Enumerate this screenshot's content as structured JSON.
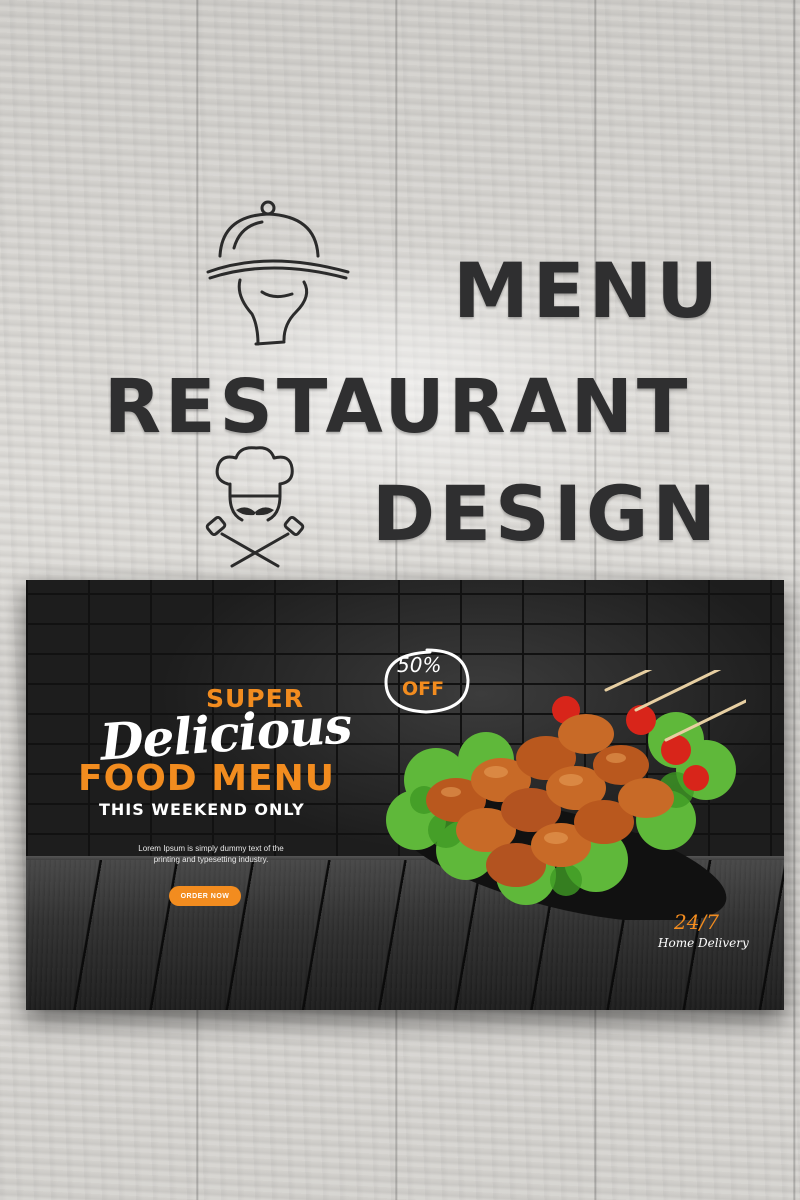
{
  "header": {
    "line1": "MENU",
    "line2": "RESTAURANT",
    "line3": "DESIGN",
    "icons": [
      "cloche-hand-icon",
      "chef-mustache-icon"
    ]
  },
  "banner": {
    "super": "SUPER",
    "delicious": "Delicious",
    "food_menu": "FOOD MENU",
    "weekend": "THIS WEEKEND ONLY",
    "body_line1": "Lorem Ipsum is simply dummy text of the",
    "body_line2": "printing and typesetting industry.",
    "order_button": "ORDER NOW",
    "discount_pct": "50%",
    "discount_off": "OFF",
    "hours": "24/7",
    "delivery": "Home Delivery",
    "image": "skewer-kebab-plate-image"
  },
  "colors": {
    "accent": "#f28c1f",
    "heading": "#2f2f30",
    "banner_bg": "#1e1e1e",
    "text_light": "#ffffff"
  }
}
